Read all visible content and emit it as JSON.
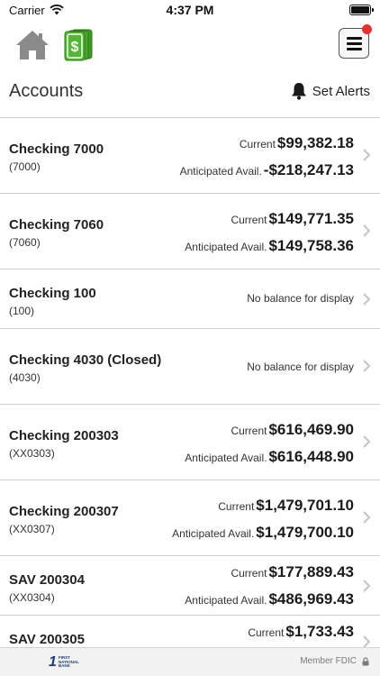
{
  "status_bar": {
    "carrier": "Carrier",
    "time": "4:37 PM"
  },
  "toolbar": {
    "home_icon": "home-icon",
    "money_icon": "cash-icon",
    "menu_icon": "hamburger-menu-icon",
    "accent": "#4caf2a"
  },
  "header": {
    "title": "Accounts",
    "alerts_label": "Set Alerts"
  },
  "accounts": [
    {
      "name": "Checking 7000",
      "number": "(7000)",
      "current_label": "Current",
      "current": "$99,382.18",
      "anticipated_label": "Anticipated Avail.",
      "anticipated": "-$218,247.13"
    },
    {
      "name": "Checking 7060",
      "number": "(7060)",
      "current_label": "Current",
      "current": "$149,771.35",
      "anticipated_label": "Anticipated Avail.",
      "anticipated": "$149,758.36"
    },
    {
      "name": "Checking 100",
      "number": "(100)",
      "no_balance": "No balance for display"
    },
    {
      "name": "Checking 4030 (Closed)",
      "number": "(4030)",
      "no_balance": "No balance for display"
    },
    {
      "name": "Checking 200303",
      "number": "(XX0303)",
      "current_label": "Current",
      "current": "$616,469.90",
      "anticipated_label": "Anticipated Avail.",
      "anticipated": "$616,448.90"
    },
    {
      "name": "Checking 200307",
      "number": "(XX0307)",
      "current_label": "Current",
      "current": "$1,479,701.10",
      "anticipated_label": "Anticipated Avail.",
      "anticipated": "$1,479,700.10"
    },
    {
      "name": "SAV 200304",
      "number": "(XX0304)",
      "current_label": "Current",
      "current": "$177,889.43",
      "anticipated_label": "Anticipated Avail.",
      "anticipated": "$486,969.43"
    },
    {
      "name": "SAV 200305",
      "current_label": "Current",
      "current": "$1,733.43"
    }
  ],
  "footer": {
    "bank_mark": "1",
    "bank_name_line1": "FIRST",
    "bank_name_line2": "NATIONAL",
    "bank_name_line3": "BANK",
    "fdic_label": "Member FDIC",
    "fdic_icon": "lock-icon"
  }
}
